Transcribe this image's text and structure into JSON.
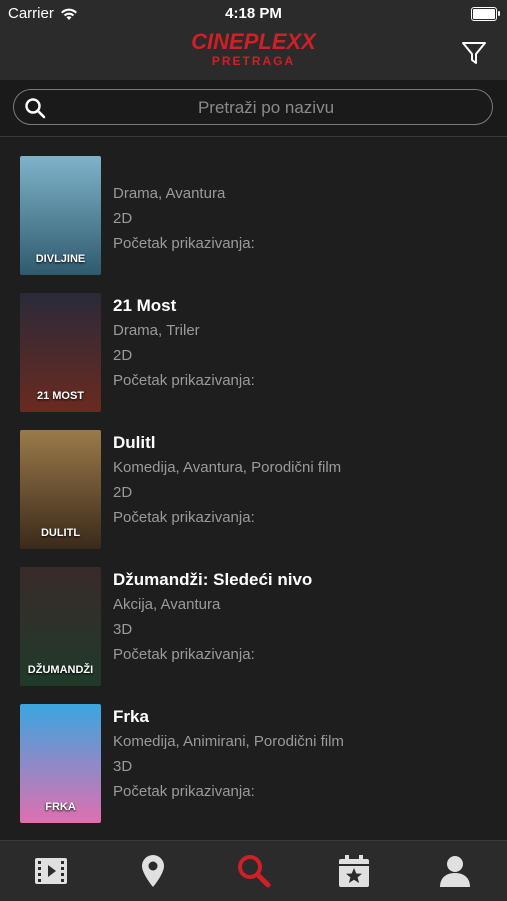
{
  "status": {
    "carrier": "Carrier",
    "time": "4:18 PM"
  },
  "header": {
    "brand": "CINEPLEXX",
    "subtitle": "PRETRAGA"
  },
  "search": {
    "placeholder": "Pretraži po nazivu"
  },
  "movies": [
    {
      "title": "",
      "genres": "Drama, Avantura",
      "format": "2D",
      "start_label": "Početak prikazivanja:",
      "poster_text": "DIVLJINE",
      "poster_colors": [
        "#7fb3c9",
        "#2f5a6e"
      ]
    },
    {
      "title": "21 Most",
      "genres": "Drama, Triler",
      "format": "2D",
      "start_label": "Početak prikazivanja:",
      "poster_text": "21 MOST",
      "poster_colors": [
        "#2a2a3a",
        "#6b2a1f"
      ]
    },
    {
      "title": "Dulitl",
      "genres": "Komedija, Avantura, Porodični film",
      "format": "2D",
      "start_label": "Početak prikazivanja:",
      "poster_text": "DULITL",
      "poster_colors": [
        "#9a7a4a",
        "#3b2a1a"
      ]
    },
    {
      "title": "Džumandži: Sledeći nivo",
      "genres": "Akcija, Avantura",
      "format": "3D",
      "start_label": "Početak prikazivanja:",
      "poster_text": "DŽUMANDŽI",
      "poster_colors": [
        "#3a2a2a",
        "#1f3a2a"
      ]
    },
    {
      "title": "Frka",
      "genres": "Komedija, Animirani, Porodični film",
      "format": "3D",
      "start_label": "Početak prikazivanja:",
      "poster_text": "FRKA",
      "poster_colors": [
        "#39a6e0",
        "#e06fb0"
      ]
    }
  ],
  "tabbar": {
    "items": [
      {
        "icon": "film-icon",
        "active": false
      },
      {
        "icon": "location-pin-icon",
        "active": false
      },
      {
        "icon": "search-icon",
        "active": true
      },
      {
        "icon": "calendar-star-icon",
        "active": false
      },
      {
        "icon": "profile-icon",
        "active": false
      }
    ],
    "active_color": "#d01f26",
    "inactive_color": "#e0e0e0"
  }
}
